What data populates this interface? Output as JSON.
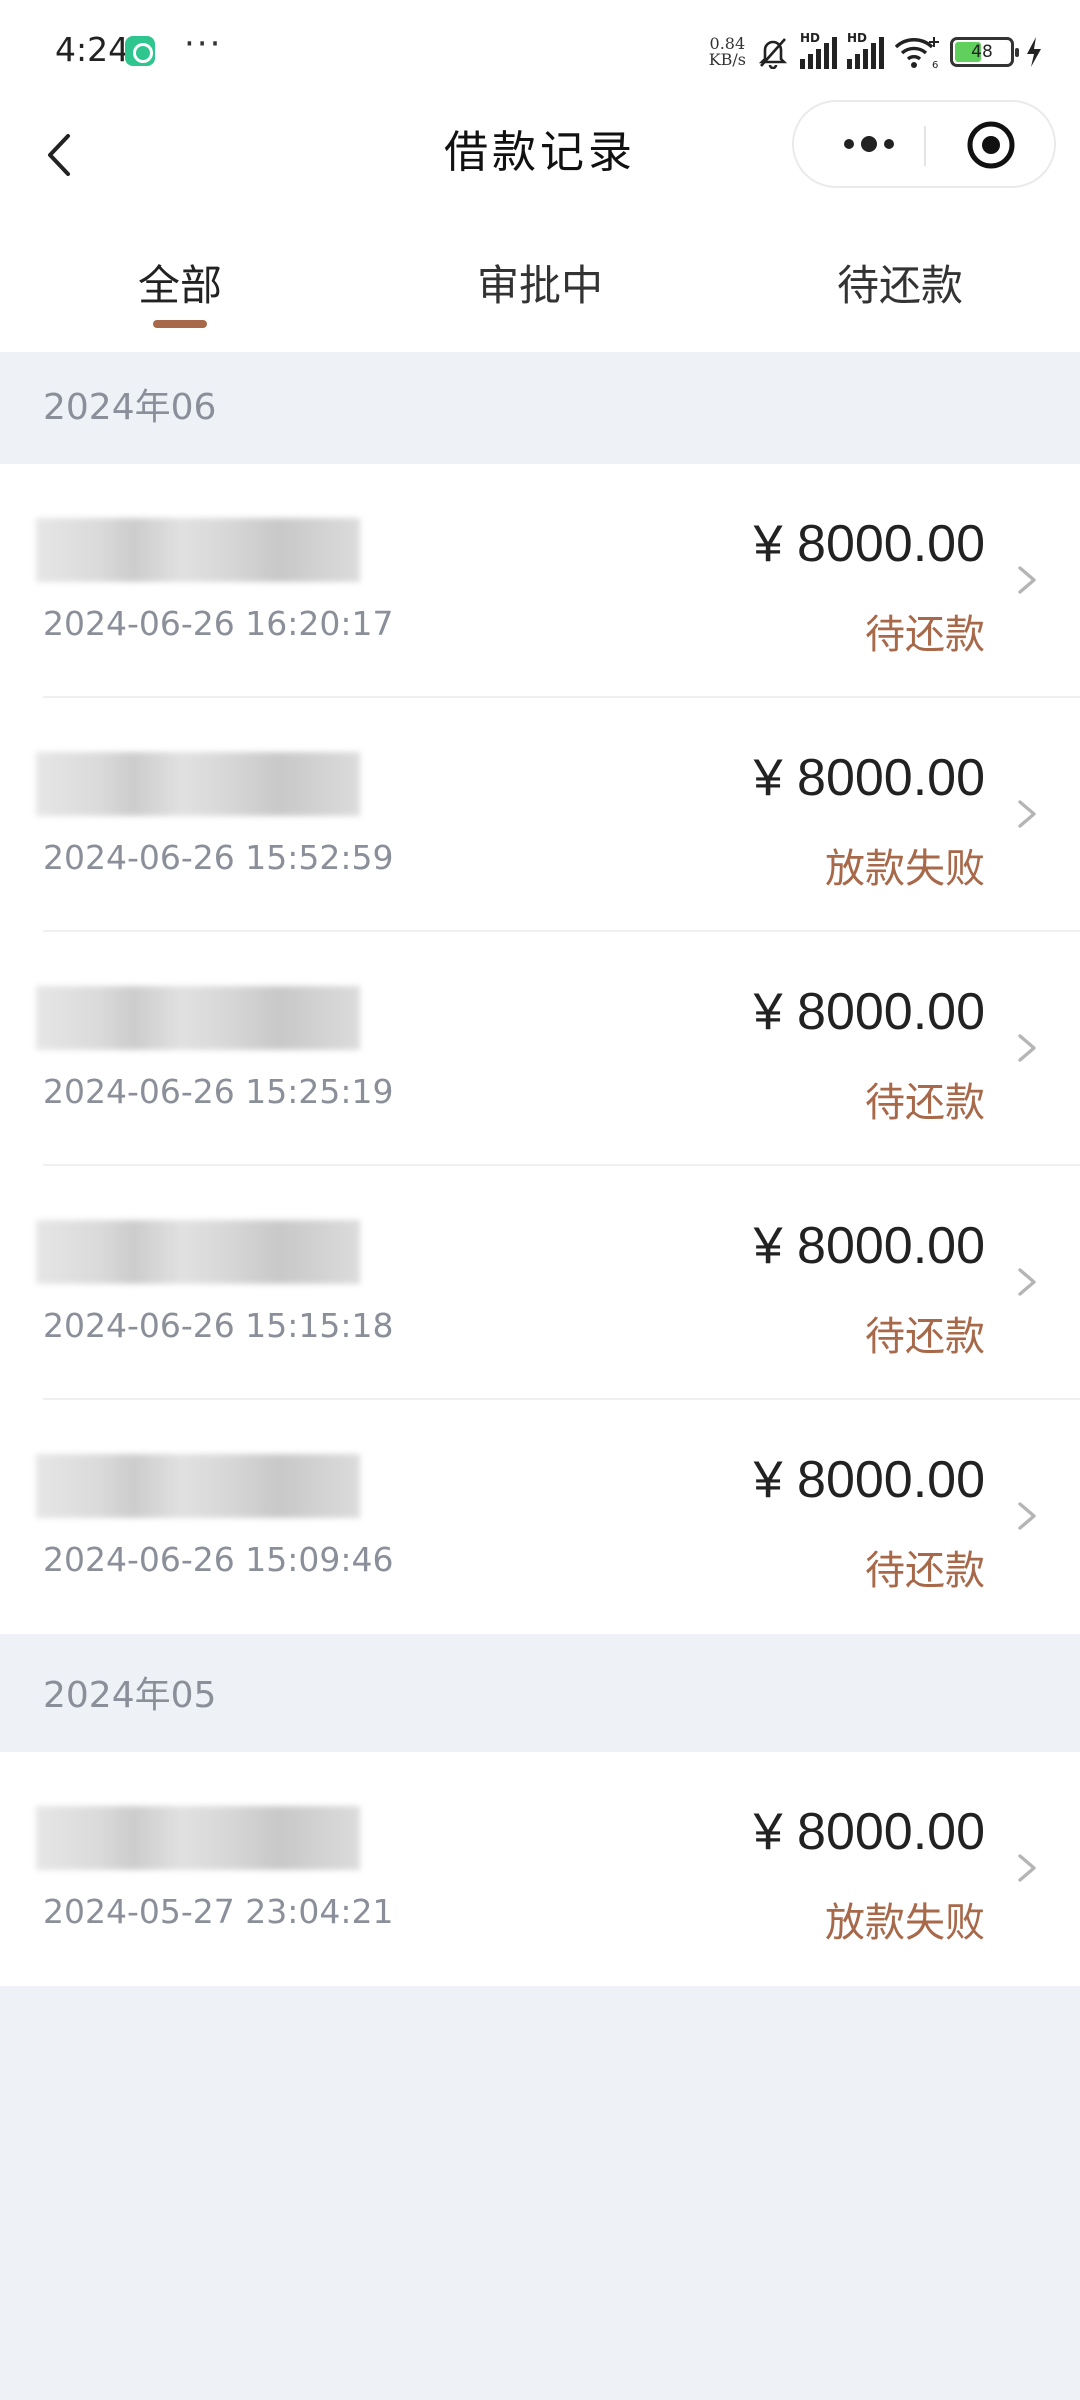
{
  "status_bar": {
    "time": "4:24",
    "more": "···",
    "net_speed_value": "0.84",
    "net_speed_unit": "KB/s",
    "signal_label_1": "HD",
    "signal_label_2": "HD",
    "wifi_sub": "6",
    "battery": "48",
    "battery_level": 0.48
  },
  "nav": {
    "title": "借款记录"
  },
  "tabs": [
    {
      "label": "全部",
      "active": true
    },
    {
      "label": "审批中",
      "active": false
    },
    {
      "label": "待还款",
      "active": false
    }
  ],
  "groups": [
    {
      "month": "2024年06",
      "records": [
        {
          "time": "2024-06-26 16:20:17",
          "amount": "¥ 8000.00",
          "status": "待还款"
        },
        {
          "time": "2024-06-26 15:52:59",
          "amount": "¥ 8000.00",
          "status": "放款失败"
        },
        {
          "time": "2024-06-26 15:25:19",
          "amount": "¥ 8000.00",
          "status": "待还款"
        },
        {
          "time": "2024-06-26 15:15:18",
          "amount": "¥ 8000.00",
          "status": "待还款"
        },
        {
          "time": "2024-06-26 15:09:46",
          "amount": "¥ 8000.00",
          "status": "待还款"
        }
      ]
    },
    {
      "month": "2024年05",
      "records": [
        {
          "time": "2024-05-27 23:04:21",
          "amount": "¥ 8000.00",
          "status": "放款失败"
        }
      ]
    }
  ],
  "colors": {
    "accent": "#a8694a",
    "page_bg": "#eef1f6",
    "muted_text": "#8a8f99"
  }
}
